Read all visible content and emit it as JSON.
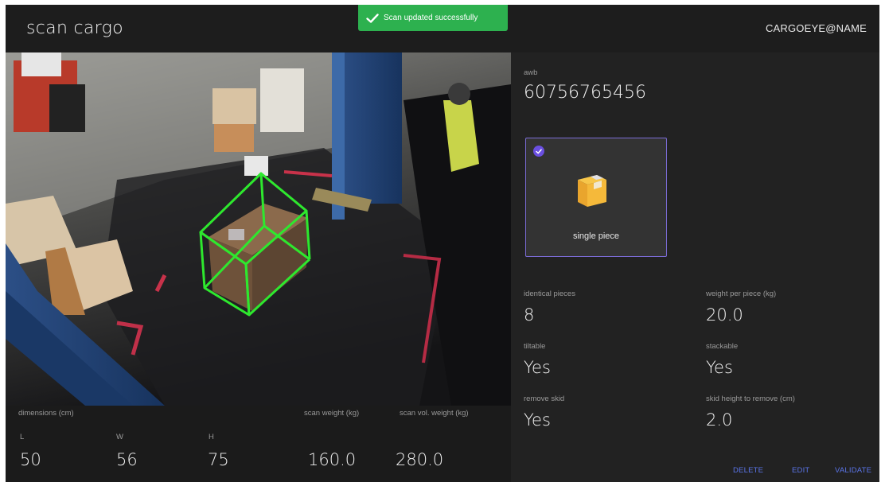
{
  "header": {
    "title": "scan cargo",
    "user": "CARGOEYE@NAME"
  },
  "toast": {
    "message": "Scan updated successfully"
  },
  "dimensions": {
    "label": "dimensions (cm)",
    "l_label": "L",
    "w_label": "W",
    "h_label": "H",
    "l_value": "50",
    "w_value": "56",
    "h_value": "75",
    "scan_weight_label": "scan weight (kg)",
    "scan_weight_value": "160.0",
    "scan_vol_weight_label": "scan vol. weight (kg)",
    "scan_vol_weight_value": "280.0"
  },
  "panel": {
    "awb_label": "awb",
    "awb_value": "60756765456",
    "piece_type": {
      "label": "single piece",
      "selected": true,
      "icon": "box-icon"
    },
    "fields": {
      "identical_pieces_label": "identical pieces",
      "identical_pieces_value": "8",
      "weight_per_piece_label": "weight per piece (kg)",
      "weight_per_piece_value": "20.0",
      "tiltable_label": "tiltable",
      "tiltable_value": "Yes",
      "stackable_label": "stackable",
      "stackable_value": "Yes",
      "remove_skid_label": "remove skid",
      "remove_skid_value": "Yes",
      "skid_height_label": "skid height to remove (cm)",
      "skid_height_value": "2.0"
    },
    "actions": {
      "delete": "DELETE",
      "edit": "EDIT",
      "validate": "VALIDATE"
    }
  },
  "colors": {
    "accent": "#6a4fe0",
    "success": "#2db14f",
    "detection": "#2ee82e",
    "action": "#5a74e8"
  }
}
